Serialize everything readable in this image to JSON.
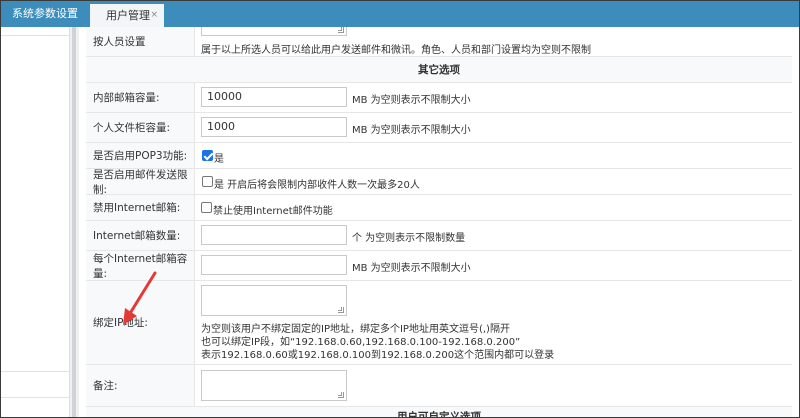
{
  "tabs": [
    {
      "label": "系统参数设置"
    },
    {
      "label": "用户管理",
      "close": "×"
    }
  ],
  "rows": {
    "person_setting": {
      "label": "按人员设置",
      "hint": "属于以上所选人员可以给此用户发送邮件和微讯。角色、人员和部门设置均为空则不限制"
    },
    "section_title": "其它选项",
    "internal_capacity": {
      "label": "内部邮箱容量:",
      "value": "10000",
      "hint": "MB 为空则表示不限制大小"
    },
    "personal_folder": {
      "label": "个人文件柜容量:",
      "value": "1000",
      "hint": "MB 为空则表示不限制大小"
    },
    "pop3": {
      "label": "是否启用POP3功能:",
      "checked": true,
      "text": "是"
    },
    "send_limit": {
      "label": "是否启用邮件发送限制:",
      "checked": false,
      "text": "是  开启后将会限制内部收件人数一次最多20人"
    },
    "disable_internet": {
      "label": "禁用Internet邮箱:",
      "checked": false,
      "text": "禁止使用Internet邮件功能"
    },
    "internet_count": {
      "label": "Internet邮箱数量:",
      "value": "",
      "hint": "个 为空则表示不限制数量"
    },
    "internet_capacity": {
      "label": "每个Internet邮箱容量:",
      "value": "",
      "hint": "MB 为空则表示不限制大小"
    },
    "bind_ip": {
      "label": "绑定IP地址:",
      "hint1": "为空则该用户不绑定固定的IP地址，绑定多个IP地址用英文逗号(,)隔开",
      "hint2": "也可以绑定IP段，如“192.168.0.60,192.168.0.100-192.168.0.200”",
      "hint3": "表示192.168.0.60或192.168.0.100到192.168.0.200这个范围内都可以登录"
    },
    "remark": {
      "label": "备注:"
    },
    "next_section": "用户可自定义选项"
  },
  "colors": {
    "tabbar": "#3c8dbc",
    "arrow": "#e53935",
    "checkbox": "#1a73e8"
  }
}
